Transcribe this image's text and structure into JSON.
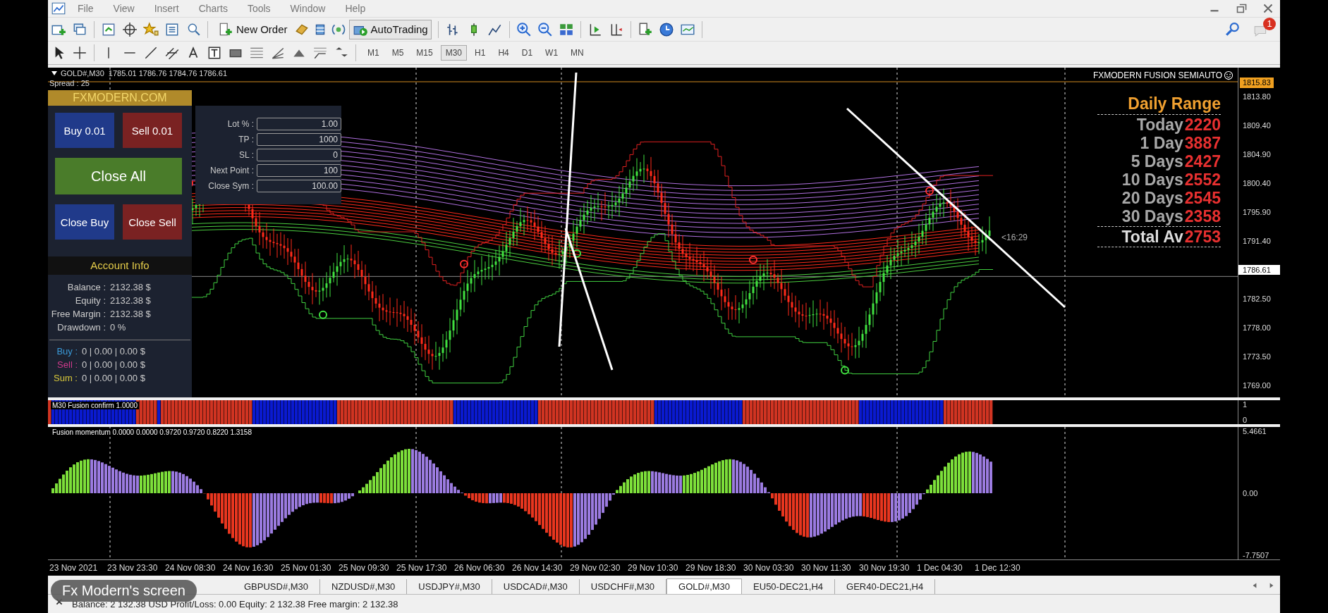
{
  "window": {
    "menu": [
      "File",
      "View",
      "Insert",
      "Charts",
      "Tools",
      "Window",
      "Help"
    ]
  },
  "toolbar": {
    "new_order": "New Order",
    "autotrading": {
      "label": "AutoTrading",
      "on": true
    },
    "notification_count": "1"
  },
  "timeframes": [
    {
      "label": "M1",
      "selected": false
    },
    {
      "label": "M5",
      "selected": false
    },
    {
      "label": "M15",
      "selected": false
    },
    {
      "label": "M30",
      "selected": true
    },
    {
      "label": "H1",
      "selected": false
    },
    {
      "label": "H4",
      "selected": false
    },
    {
      "label": "D1",
      "selected": false
    },
    {
      "label": "W1",
      "selected": false
    },
    {
      "label": "MN",
      "selected": false
    }
  ],
  "chart": {
    "header": "GOLD#,M30  1785.01 1786.76 1784.76 1786.61",
    "spread": "Spread : 25",
    "indicator_title": "FXMODERN FUSION SEMIAUTO",
    "price_line_label": "1815.83",
    "line_tag": "<16:29",
    "price_axis": [
      {
        "value": "1813.80",
        "kind": "tick"
      },
      {
        "value": "1809.40",
        "kind": "tick"
      },
      {
        "value": "1804.90",
        "kind": "tick"
      },
      {
        "value": "1800.40",
        "kind": "tick"
      },
      {
        "value": "1795.90",
        "kind": "tick"
      },
      {
        "value": "1791.40",
        "kind": "tick"
      },
      {
        "value": "1786.61",
        "kind": "current"
      },
      {
        "value": "1782.50",
        "kind": "tick"
      },
      {
        "value": "1778.00",
        "kind": "tick"
      },
      {
        "value": "1773.50",
        "kind": "tick"
      },
      {
        "value": "1769.00",
        "kind": "tick"
      }
    ]
  },
  "panel": {
    "brand": "FXMODERN.COM",
    "buttons": [
      {
        "label": "Buy 0.01",
        "kind": "buy"
      },
      {
        "label": "Sell 0.01",
        "kind": "sell"
      },
      {
        "label": "Close All",
        "kind": "close_all"
      },
      {
        "label": "Close Buy",
        "kind": "buy"
      },
      {
        "label": "Close Sell",
        "kind": "sell"
      }
    ],
    "fields": [
      {
        "label": "Lot % :",
        "value": "1.00"
      },
      {
        "label": "TP :",
        "value": "1000"
      },
      {
        "label": "SL :",
        "value": "0"
      },
      {
        "label": "Next Point :",
        "value": "100"
      },
      {
        "label": "Close Sym :",
        "value": "100.00"
      }
    ],
    "account_title": "Account Info",
    "account": [
      {
        "label": "Balance :",
        "value": "2132.38 $"
      },
      {
        "label": "Equity :",
        "value": "2132.38 $"
      },
      {
        "label": "Free Margin :",
        "value": "2132.38 $"
      },
      {
        "label": "Drawdown :",
        "value": "0 %"
      }
    ],
    "positions": [
      {
        "label": "Buy :",
        "value": "0 | 0.00 | 0.00 $",
        "color": "#3a9ad9"
      },
      {
        "label": "Sell :",
        "value": "0 | 0.00 | 0.00 $",
        "color": "#d03a8c"
      },
      {
        "label": "Sum :",
        "value": "0 | 0.00 | 0.00 $",
        "color": "#d8c83a"
      }
    ]
  },
  "daily_range": {
    "title": "Daily Range",
    "rows": [
      {
        "label": "Today",
        "value": "2220"
      },
      {
        "label": "1 Day",
        "value": "3887"
      },
      {
        "label": "5 Days",
        "value": "2427"
      },
      {
        "label": "10 Days",
        "value": "2552"
      },
      {
        "label": "20 Days",
        "value": "2545"
      },
      {
        "label": "30 Days",
        "value": "2358"
      }
    ],
    "total": {
      "label": "Total Av",
      "value": "2753"
    }
  },
  "confirm": {
    "label": "M30 Fusion confirm 1.0000",
    "axis": [
      "1",
      "0"
    ]
  },
  "momentum": {
    "label": "Fusion momentum 0.0000 0.0000 0.9720 0.9720 0.8220 1.3158",
    "axis": [
      "5.4661",
      "0.00",
      "-7.7507"
    ]
  },
  "time_axis": [
    "23 Nov 2021",
    "23 Nov 23:30",
    "24 Nov 08:30",
    "24 Nov 16:30",
    "25 Nov 01:30",
    "25 Nov 09:30",
    "25 Nov 17:30",
    "26 Nov 06:30",
    "26 Nov 14:30",
    "29 Nov 02:30",
    "29 Nov 10:30",
    "29 Nov 18:30",
    "30 Nov 03:30",
    "30 Nov 11:30",
    "30 Nov 19:30",
    "1 Dec 04:30",
    "1 Dec 12:30"
  ],
  "tabs": [
    {
      "label": "GBPUSD#,M30",
      "selected": false
    },
    {
      "label": "NZDUSD#,M30",
      "selected": false
    },
    {
      "label": "USDJPY#,M30",
      "selected": false
    },
    {
      "label": "USDCAD#,M30",
      "selected": false
    },
    {
      "label": "USDCHF#,M30",
      "selected": false
    },
    {
      "label": "GOLD#,M30",
      "selected": true
    },
    {
      "label": "EU50-DEC21,H4",
      "selected": false
    },
    {
      "label": "GER40-DEC21,H4",
      "selected": false
    }
  ],
  "status_bar": "Balance: 2 132.38 USD  Profit/Loss: 0.00  Equity: 2 132.38  Free margin: 2 132.38",
  "overlay_caption": "Fx Modern's screen"
}
